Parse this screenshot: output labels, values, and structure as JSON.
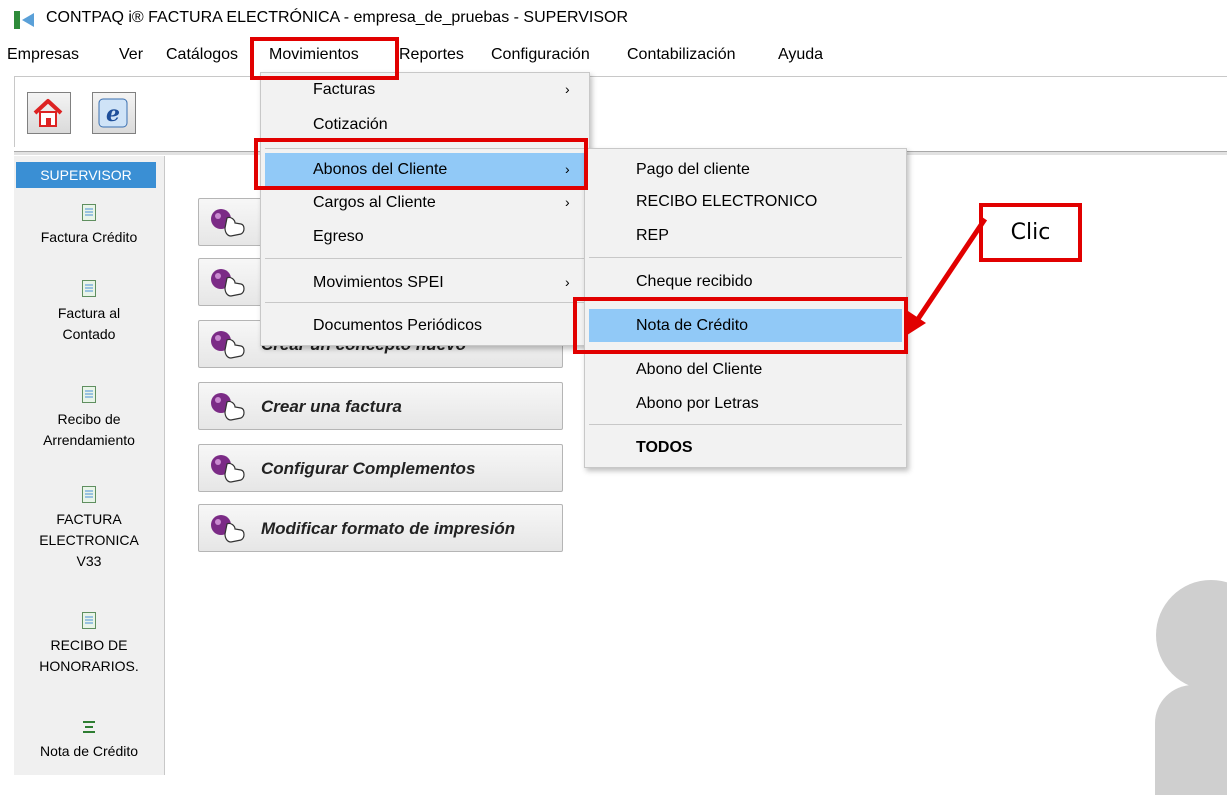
{
  "window": {
    "title": "CONTPAQ i® FACTURA ELECTRÓNICA - empresa_de_pruebas - SUPERVISOR"
  },
  "menubar": [
    "Empresas",
    "Ver",
    "Catálogos",
    "Movimientos",
    "Reportes",
    "Configuración",
    "Contabilización",
    "Ayuda"
  ],
  "toolbar": {
    "icons": [
      "home-icon",
      "e-icon"
    ]
  },
  "sidebar": {
    "header": "SUPERVISOR",
    "items": [
      {
        "l1": "Factura Crédito",
        "l2": "",
        "l3": ""
      },
      {
        "l1": "Factura al",
        "l2": "Contado",
        "l3": ""
      },
      {
        "l1": "Recibo de",
        "l2": "Arrendamiento",
        "l3": ""
      },
      {
        "l1": "FACTURA",
        "l2": "ELECTRONICA",
        "l3": "V33"
      },
      {
        "l1": "RECIBO DE",
        "l2": "HONORARIOS.",
        "l3": ""
      },
      {
        "l1": "Nota de Crédito",
        "l2": "",
        "l3": ""
      }
    ]
  },
  "main": {
    "tasks": [
      "",
      "",
      "Crear un concepto nuevo",
      "Crear una factura",
      "Configurar Complementos",
      "Modificar formato de impresión"
    ]
  },
  "movimientos_menu": [
    "Facturas",
    "Cotización",
    "Abonos del Cliente",
    "Cargos al Cliente",
    "Egreso",
    "Movimientos SPEI",
    "Documentos Periódicos"
  ],
  "abonos_submenu": [
    "Pago del cliente",
    "RECIBO ELECTRONICO",
    "REP",
    "Cheque recibido",
    "Nota de Crédito",
    "Abono del Cliente",
    "Abono por Letras",
    "TODOS"
  ],
  "annotation": {
    "callout": "Clic"
  },
  "colors": {
    "highlight": "#91c9f7",
    "annotation": "#e10000",
    "sidebar_header": "#3a8fd4"
  }
}
